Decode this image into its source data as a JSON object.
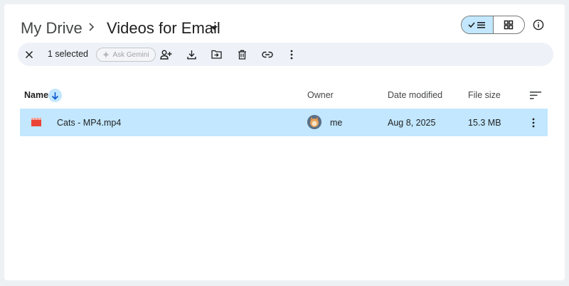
{
  "breadcrumb": {
    "root": "My Drive",
    "current": "Videos for Email"
  },
  "view": {
    "mode": "list"
  },
  "toolbar": {
    "selected_text": "1 selected",
    "ask_gemini": "Ask Gemini"
  },
  "table": {
    "columns": [
      "Name",
      "Owner",
      "Date modified",
      "File size"
    ],
    "sort": "Name descending",
    "rows": [
      {
        "name": "Cats - MP4.mp4",
        "owner": "me",
        "date_modified": "Aug 8, 2025",
        "file_size": "15.3 MB",
        "selected": true
      }
    ]
  },
  "colors": {
    "accent": "#0b57d0",
    "selection": "#c2e7ff",
    "video_icon": "#ea4335",
    "toolbar_bg": "#eef2f8"
  }
}
